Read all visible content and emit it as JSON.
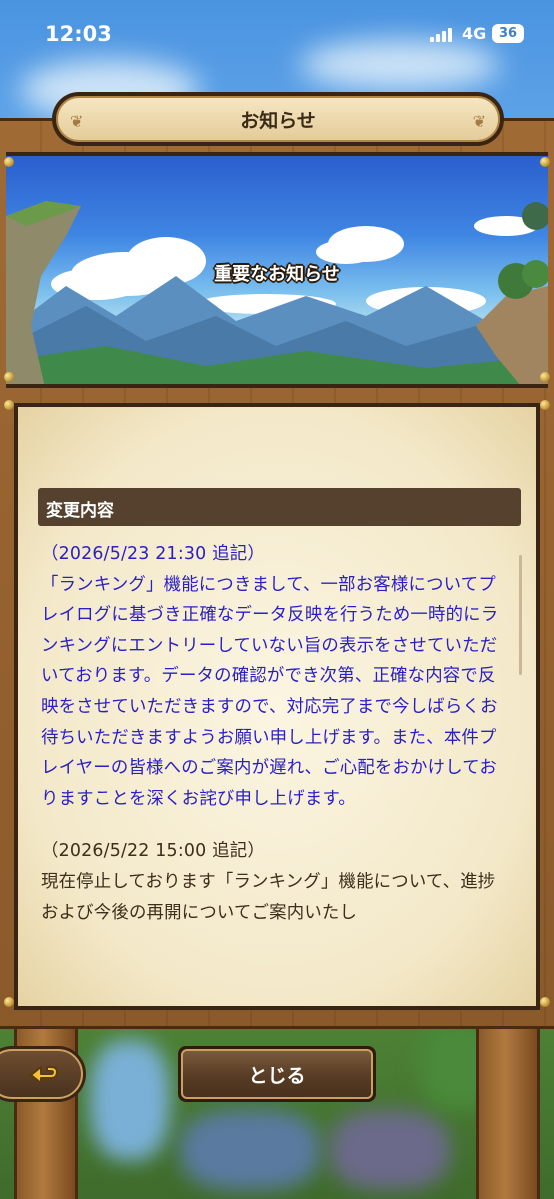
{
  "status_bar": {
    "time": "12:03",
    "network": "4G",
    "battery": "36"
  },
  "window": {
    "title": "お知らせ"
  },
  "banner": {
    "title": "重要なお知らせ"
  },
  "notice": {
    "section_header": "変更内容",
    "updates": [
      {
        "date_note": "（2026/5/23 21:30 追記）",
        "body": "「ランキング」機能につきまして、一部お客様についてプレイログに基づき正確なデータ反映を行うため一時的にランキングにエントリーしていない旨の表示をさせていただいております。データの確認ができ次第、正確な内容で反映をさせていただきますので、対応完了まで今しばらくお待ちいただきますようお願い申し上げます。また、本件プレイヤーの皆様へのご案内が遅れ、ご心配をおかけしておりますことを深くお詫び申し上げます。"
      },
      {
        "date_note": "（2026/5/22 15:00 追記）",
        "body": "現在停止しております「ランキング」機能について、進捗および今後の再開についてご案内いたし"
      }
    ]
  },
  "buttons": {
    "back_icon": "return-arrow-icon",
    "close_label": "とじる"
  },
  "colors": {
    "highlight_text": "#2a1fc6",
    "normal_text": "#3e2e1c",
    "section_header_bg": "#55412e"
  }
}
